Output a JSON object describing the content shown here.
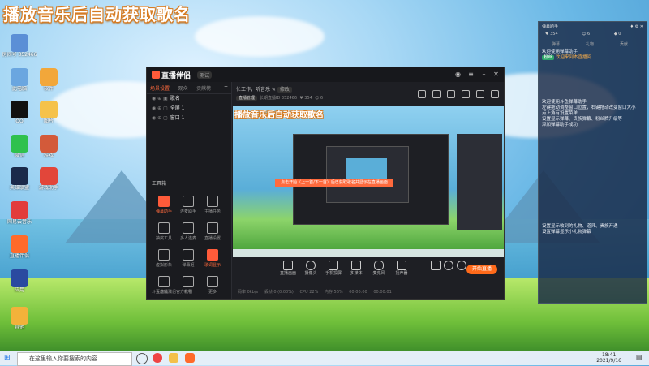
{
  "overlay_title": "播放音乐后自动获取歌名",
  "desktop_icons": [
    {
      "label": "房间号 352466",
      "color": "#5b8fd6"
    },
    {
      "label": "此电脑",
      "color": "#6aa6e0"
    },
    {
      "label": "软件",
      "color": "#f2a73a"
    },
    {
      "label": "QQ",
      "color": "#111"
    },
    {
      "label": "图片",
      "color": "#f5c24a"
    },
    {
      "label": "微信",
      "color": "#2fc14d"
    },
    {
      "label": "游戏",
      "color": "#d35a3a"
    },
    {
      "label": "英雄联盟",
      "color": "#1a2a4a"
    },
    {
      "label": "游戏助手",
      "color": "#e2463a"
    },
    {
      "label": "网易云音乐",
      "color": "#e23c3c"
    },
    {
      "label": "直播伴侣",
      "color": "#ff6a2a"
    },
    {
      "label": "应用",
      "color": "#2a4aa0"
    },
    {
      "label": "其他",
      "color": "#f3b23a"
    }
  ],
  "app": {
    "logo": "直播伴侣",
    "version": "测试",
    "left_tabs": [
      "场景设置",
      "观众",
      "贡献榜"
    ],
    "scenes": [
      "歌名",
      "全屏 1",
      "窗口 1"
    ],
    "tools_header": "工具箱",
    "tools": [
      {
        "label": "弹幕助手",
        "hot": true
      },
      {
        "label": "连麦助手",
        "hot": false
      },
      {
        "label": "主播任务",
        "hot": false
      },
      {
        "label": "抽奖工具",
        "hot": false
      },
      {
        "label": "多人连麦",
        "hot": false
      },
      {
        "label": "直播设置",
        "hot": false
      },
      {
        "label": "虚拟形象",
        "hot": false
      },
      {
        "label": "弹幕姬",
        "hot": false
      },
      {
        "label": "歌词显示",
        "hot": true
      },
      {
        "label": "互动玩法",
        "hot": false
      },
      {
        "label": "礼物",
        "hot": false
      },
      {
        "label": "更多",
        "hot": false
      }
    ],
    "left_footer": "斗鱼直播伴侣官方教程",
    "room_title": "忙工作，听音乐",
    "room_tag": "修改",
    "room_meta_tag": "直播管理",
    "room_meta": "长期直播ID 352466",
    "likes": "354",
    "fans": "6",
    "preview_title": "播放音乐后自动获取歌名",
    "banner_text": "点击开始（上一首/下一首）后已获取歌名并显示在直播画面",
    "controls": [
      "直播画面",
      "摄像头",
      "手机投屏",
      "多媒体",
      "麦克风",
      "扬声器"
    ],
    "start_button": "开始直播",
    "status_items": [
      "码率 0kb/s",
      "丢帧 0 (0.00%)",
      "CPU 22%",
      "内存 56%",
      "00:00:00",
      "00:00:01"
    ]
  },
  "chat": {
    "title": "弹幕助手",
    "stats": [
      "354",
      "6",
      "0"
    ],
    "tabs": [
      "弹幕",
      "礼物",
      "贡献"
    ],
    "messages": [
      {
        "text": "欢迎使用弹幕助手"
      },
      {
        "tag": "粉丝",
        "text": "欢迎来到本直播间",
        "highlight": true
      },
      {
        "text": "欢迎使用斗鱼弹幕助手"
      },
      {
        "text": "左键拖动调整窗口位置，右键拖动改变窗口大小"
      },
      {
        "text": "点上角有设置菜单"
      },
      {
        "text": "设置显示弹幕、贵族弹幕、粉丝牌升级等"
      },
      {
        "text": "添加弹幕助手成功"
      },
      {
        "text": "设置显示收到的礼物、道具、贵族开通"
      },
      {
        "text": "设置弹幕显示小礼物弹幕"
      }
    ]
  },
  "taskbar": {
    "search_placeholder": "在这里输入你要搜索的内容",
    "time": "18:41",
    "date": "2021/9/16"
  }
}
